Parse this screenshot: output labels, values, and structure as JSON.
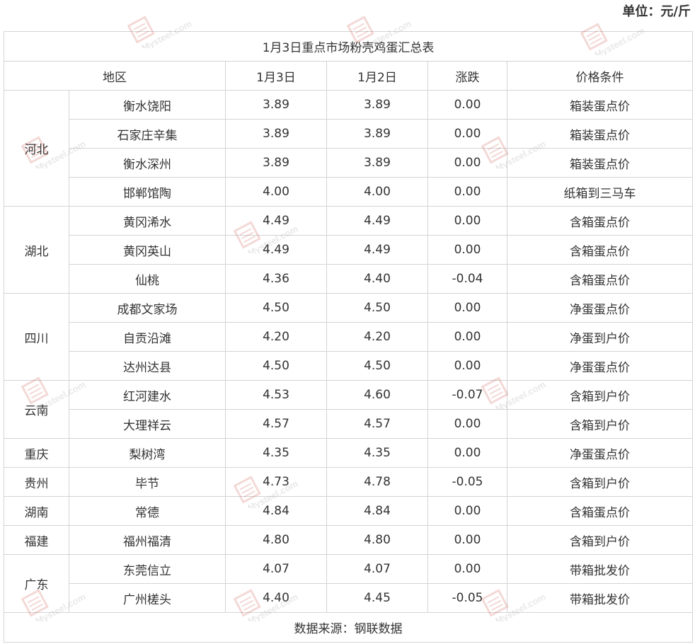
{
  "unit_label": "单位：元/斤",
  "table": {
    "title": "1月3日重点市场粉壳鸡蛋汇总表",
    "headers": [
      "地区",
      "1月3日",
      "1月2日",
      "涨跌",
      "价格条件"
    ],
    "groups": [
      {
        "province": "河北",
        "rows": [
          {
            "market": "衡水饶阳",
            "d1": "3.89",
            "d2": "3.89",
            "change": "0.00",
            "cond": "箱装蛋点价"
          },
          {
            "market": "石家庄辛集",
            "d1": "3.89",
            "d2": "3.89",
            "change": "0.00",
            "cond": "箱装蛋点价"
          },
          {
            "market": "衡水深州",
            "d1": "3.89",
            "d2": "3.89",
            "change": "0.00",
            "cond": "箱装蛋点价"
          },
          {
            "market": "邯郸馆陶",
            "d1": "4.00",
            "d2": "4.00",
            "change": "0.00",
            "cond": "纸箱到三马车"
          }
        ]
      },
      {
        "province": "湖北",
        "rows": [
          {
            "market": "黄冈浠水",
            "d1": "4.49",
            "d2": "4.49",
            "change": "0.00",
            "cond": "含箱蛋点价"
          },
          {
            "market": "黄冈英山",
            "d1": "4.49",
            "d2": "4.49",
            "change": "0.00",
            "cond": "含箱蛋点价"
          },
          {
            "market": "仙桃",
            "d1": "4.36",
            "d2": "4.40",
            "change": "-0.04",
            "cond": "含箱蛋点价"
          }
        ]
      },
      {
        "province": "四川",
        "rows": [
          {
            "market": "成都文家场",
            "d1": "4.50",
            "d2": "4.50",
            "change": "0.00",
            "cond": "净蛋蛋点价"
          },
          {
            "market": "自贡沿滩",
            "d1": "4.20",
            "d2": "4.20",
            "change": "0.00",
            "cond": "净蛋到户价"
          },
          {
            "market": "达州达县",
            "d1": "4.50",
            "d2": "4.50",
            "change": "0.00",
            "cond": "净蛋蛋点价"
          }
        ]
      },
      {
        "province": "云南",
        "rows": [
          {
            "market": "红河建水",
            "d1": "4.53",
            "d2": "4.60",
            "change": "-0.07",
            "cond": "含箱到户价"
          },
          {
            "market": "大理祥云",
            "d1": "4.57",
            "d2": "4.57",
            "change": "0.00",
            "cond": "含箱到户价"
          }
        ]
      },
      {
        "province": "重庆",
        "rows": [
          {
            "market": "梨树湾",
            "d1": "4.35",
            "d2": "4.35",
            "change": "0.00",
            "cond": "净蛋蛋点价"
          }
        ]
      },
      {
        "province": "贵州",
        "rows": [
          {
            "market": "毕节",
            "d1": "4.73",
            "d2": "4.78",
            "change": "-0.05",
            "cond": "含箱到户价"
          }
        ]
      },
      {
        "province": "湖南",
        "rows": [
          {
            "market": "常德",
            "d1": "4.84",
            "d2": "4.84",
            "change": "0.00",
            "cond": "含箱蛋点价"
          }
        ]
      },
      {
        "province": "福建",
        "rows": [
          {
            "market": "福州福清",
            "d1": "4.80",
            "d2": "4.80",
            "change": "0.00",
            "cond": "含箱到户价"
          }
        ]
      },
      {
        "province": "广东",
        "rows": [
          {
            "market": "东莞信立",
            "d1": "4.07",
            "d2": "4.07",
            "change": "0.00",
            "cond": "带箱批发价"
          },
          {
            "market": "广州槎头",
            "d1": "4.40",
            "d2": "4.45",
            "change": "-0.05",
            "cond": "带箱批发价"
          }
        ]
      }
    ],
    "footer": "数据来源：钢联数据"
  },
  "watermark": {
    "text": "Mysteel.com",
    "logo_icon": "mysteel-logo-icon"
  },
  "colors": {
    "negative_change": "#1a9c3c",
    "border": "#d4d4d4",
    "text": "#333333"
  }
}
